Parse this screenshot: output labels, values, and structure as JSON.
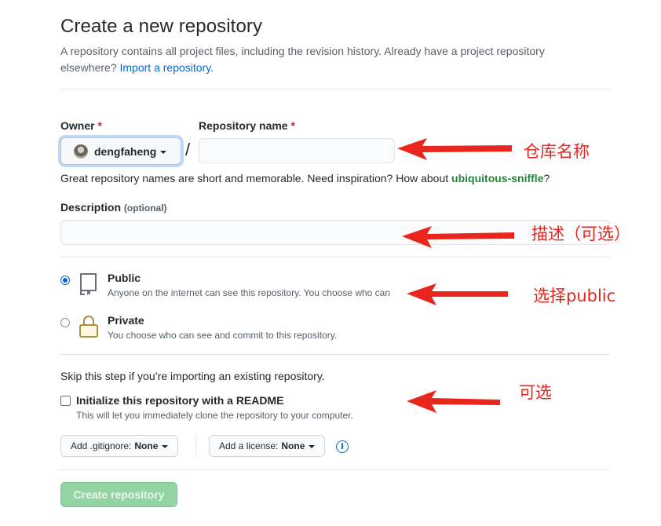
{
  "header": {
    "title": "Create a new repository",
    "subtitle": "A repository contains all project files, including the revision history. Already have a project repository elsewhere?",
    "import_link": "Import a repository."
  },
  "owner": {
    "label": "Owner",
    "required_mark": "*",
    "value": "dengfaheng"
  },
  "repo_name": {
    "label": "Repository name",
    "required_mark": "*",
    "value": "",
    "separator": "/"
  },
  "name_hint": {
    "text": "Great repository names are short and memorable. Need inspiration? How about",
    "suggestion": "ubiquitous-sniffle",
    "suffix": "?"
  },
  "description": {
    "label": "Description",
    "optional": "(optional)",
    "value": ""
  },
  "visibility": {
    "selected": "public",
    "public": {
      "title": "Public",
      "desc": "Anyone on the internet can see this repository. You choose who can"
    },
    "private": {
      "title": "Private",
      "desc": "You choose who can see and commit to this repository."
    }
  },
  "init": {
    "skip_text": "Skip this step if you’re importing an existing repository.",
    "readme_label": "Initialize this repository with a README",
    "readme_desc": "This will let you immediately clone the repository to your computer.",
    "readme_checked": false
  },
  "gitignore": {
    "label": "Add .gitignore:",
    "value": "None"
  },
  "license": {
    "label": "Add a license:",
    "value": "None"
  },
  "create_button": "Create repository",
  "annotations": {
    "repo_name": "仓库名称",
    "description": "描述（可选）",
    "public": "选择public",
    "readme": "可选",
    "color": "#e8261d"
  }
}
